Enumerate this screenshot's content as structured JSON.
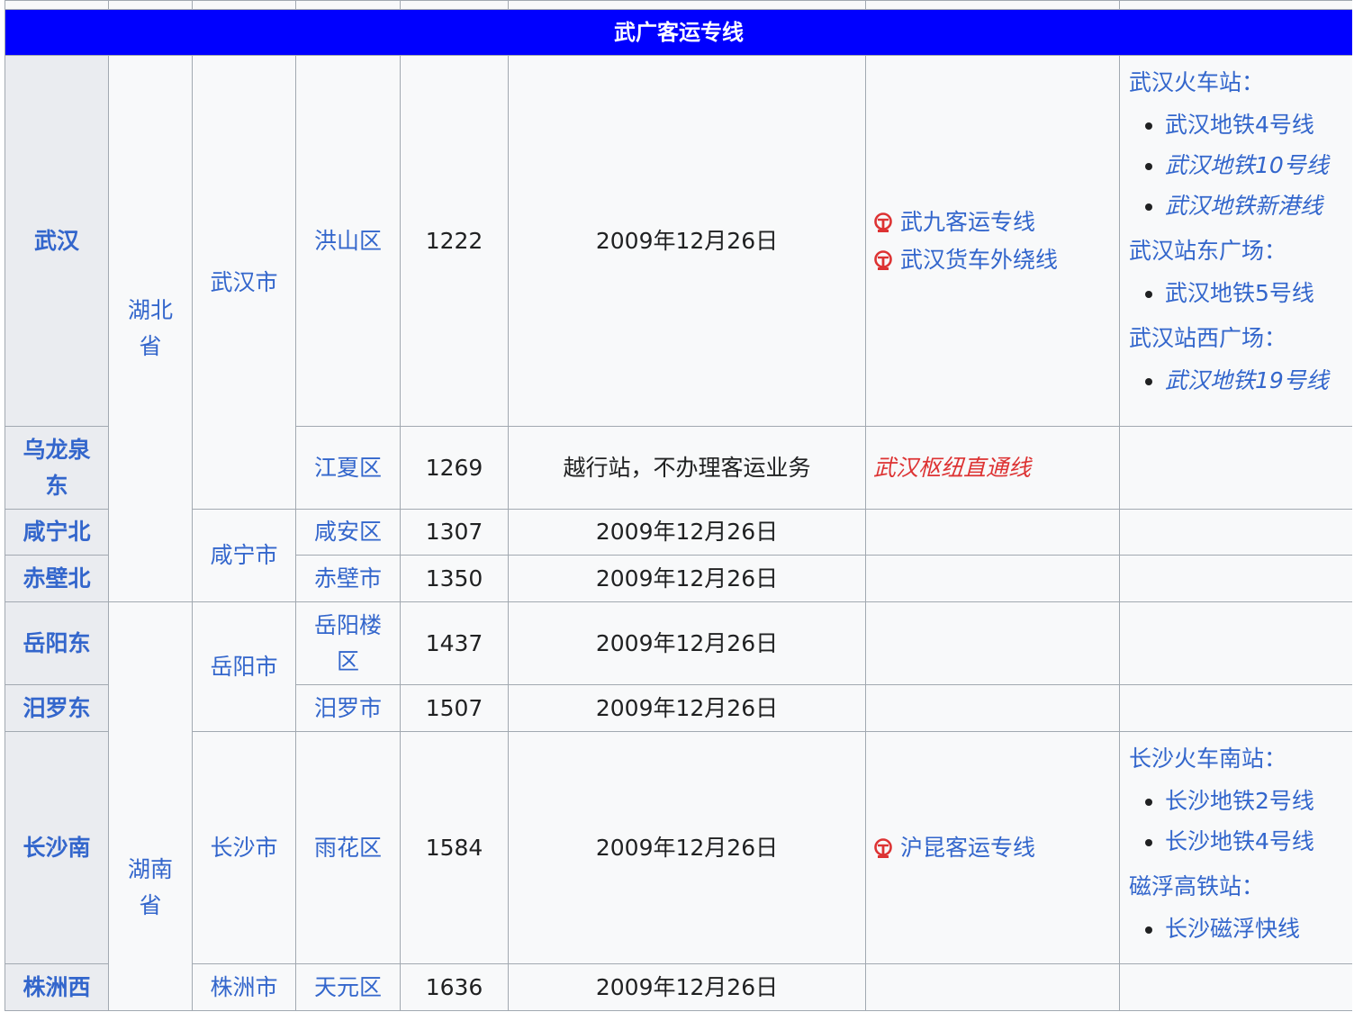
{
  "section_title": "武广客运专线",
  "rows": {
    "wuhan": {
      "station": "武汉",
      "district": "洪山区",
      "km": "1222",
      "date": "2009年12月26日"
    },
    "wulongquan": {
      "station": "乌龙泉东",
      "district": "江夏区",
      "km": "1269",
      "date": "越行站，不办理客运业务"
    },
    "xianning": {
      "station": "咸宁北",
      "district": "咸安区",
      "km": "1307",
      "date": "2009年12月26日"
    },
    "chibi": {
      "station": "赤壁北",
      "district": "赤壁市",
      "km": "1350",
      "date": "2009年12月26日"
    },
    "yueyang": {
      "station": "岳阳东",
      "district": "岳阳楼区",
      "km": "1437",
      "date": "2009年12月26日"
    },
    "miluo": {
      "station": "汨罗东",
      "district": "汨罗市",
      "km": "1507",
      "date": "2009年12月26日"
    },
    "changsha": {
      "station": "长沙南",
      "district": "雨花区",
      "km": "1584",
      "date": "2009年12月26日"
    },
    "zhuzhou": {
      "station": "株洲西",
      "district": "天元区",
      "km": "1636",
      "date": "2009年12月26日"
    }
  },
  "provinces": {
    "hubei": "湖北省",
    "hunan": "湖南省"
  },
  "cities": {
    "wuhan": "武汉市",
    "xianning": "咸宁市",
    "yueyang": "岳阳市",
    "changsha": "长沙市",
    "zhuzhou": "株洲市"
  },
  "rail_connections": {
    "wuhan": [
      "武九客运专线",
      "武汉货车外绕线"
    ],
    "wulongquan": "武汉枢纽直通线",
    "changsha": [
      "沪昆客运专线"
    ]
  },
  "transfers": {
    "wuhan": {
      "group1": {
        "heading": "武汉火车站：",
        "items": [
          "武汉地铁4号线",
          "武汉地铁10号线",
          "武汉地铁新港线"
        ]
      },
      "group2": {
        "heading": "武汉站东广场：",
        "items": [
          "武汉地铁5号线"
        ]
      },
      "group3": {
        "heading": "武汉站西广场：",
        "items": [
          "武汉地铁19号线"
        ]
      }
    },
    "changsha": {
      "group1": {
        "heading": "长沙火车南站：",
        "items": [
          "长沙地铁2号线",
          "长沙地铁4号线"
        ]
      },
      "group2": {
        "heading": "磁浮高铁站：",
        "items": [
          "长沙磁浮快线"
        ]
      }
    }
  },
  "colors": {
    "header_bg": "#0000ff",
    "link": "#3366cc",
    "redlink": "#dd3333",
    "station_bg": "#eaecf0",
    "cell_bg": "#f8f9fa"
  },
  "icons": {
    "rail": "china-railway-icon"
  }
}
